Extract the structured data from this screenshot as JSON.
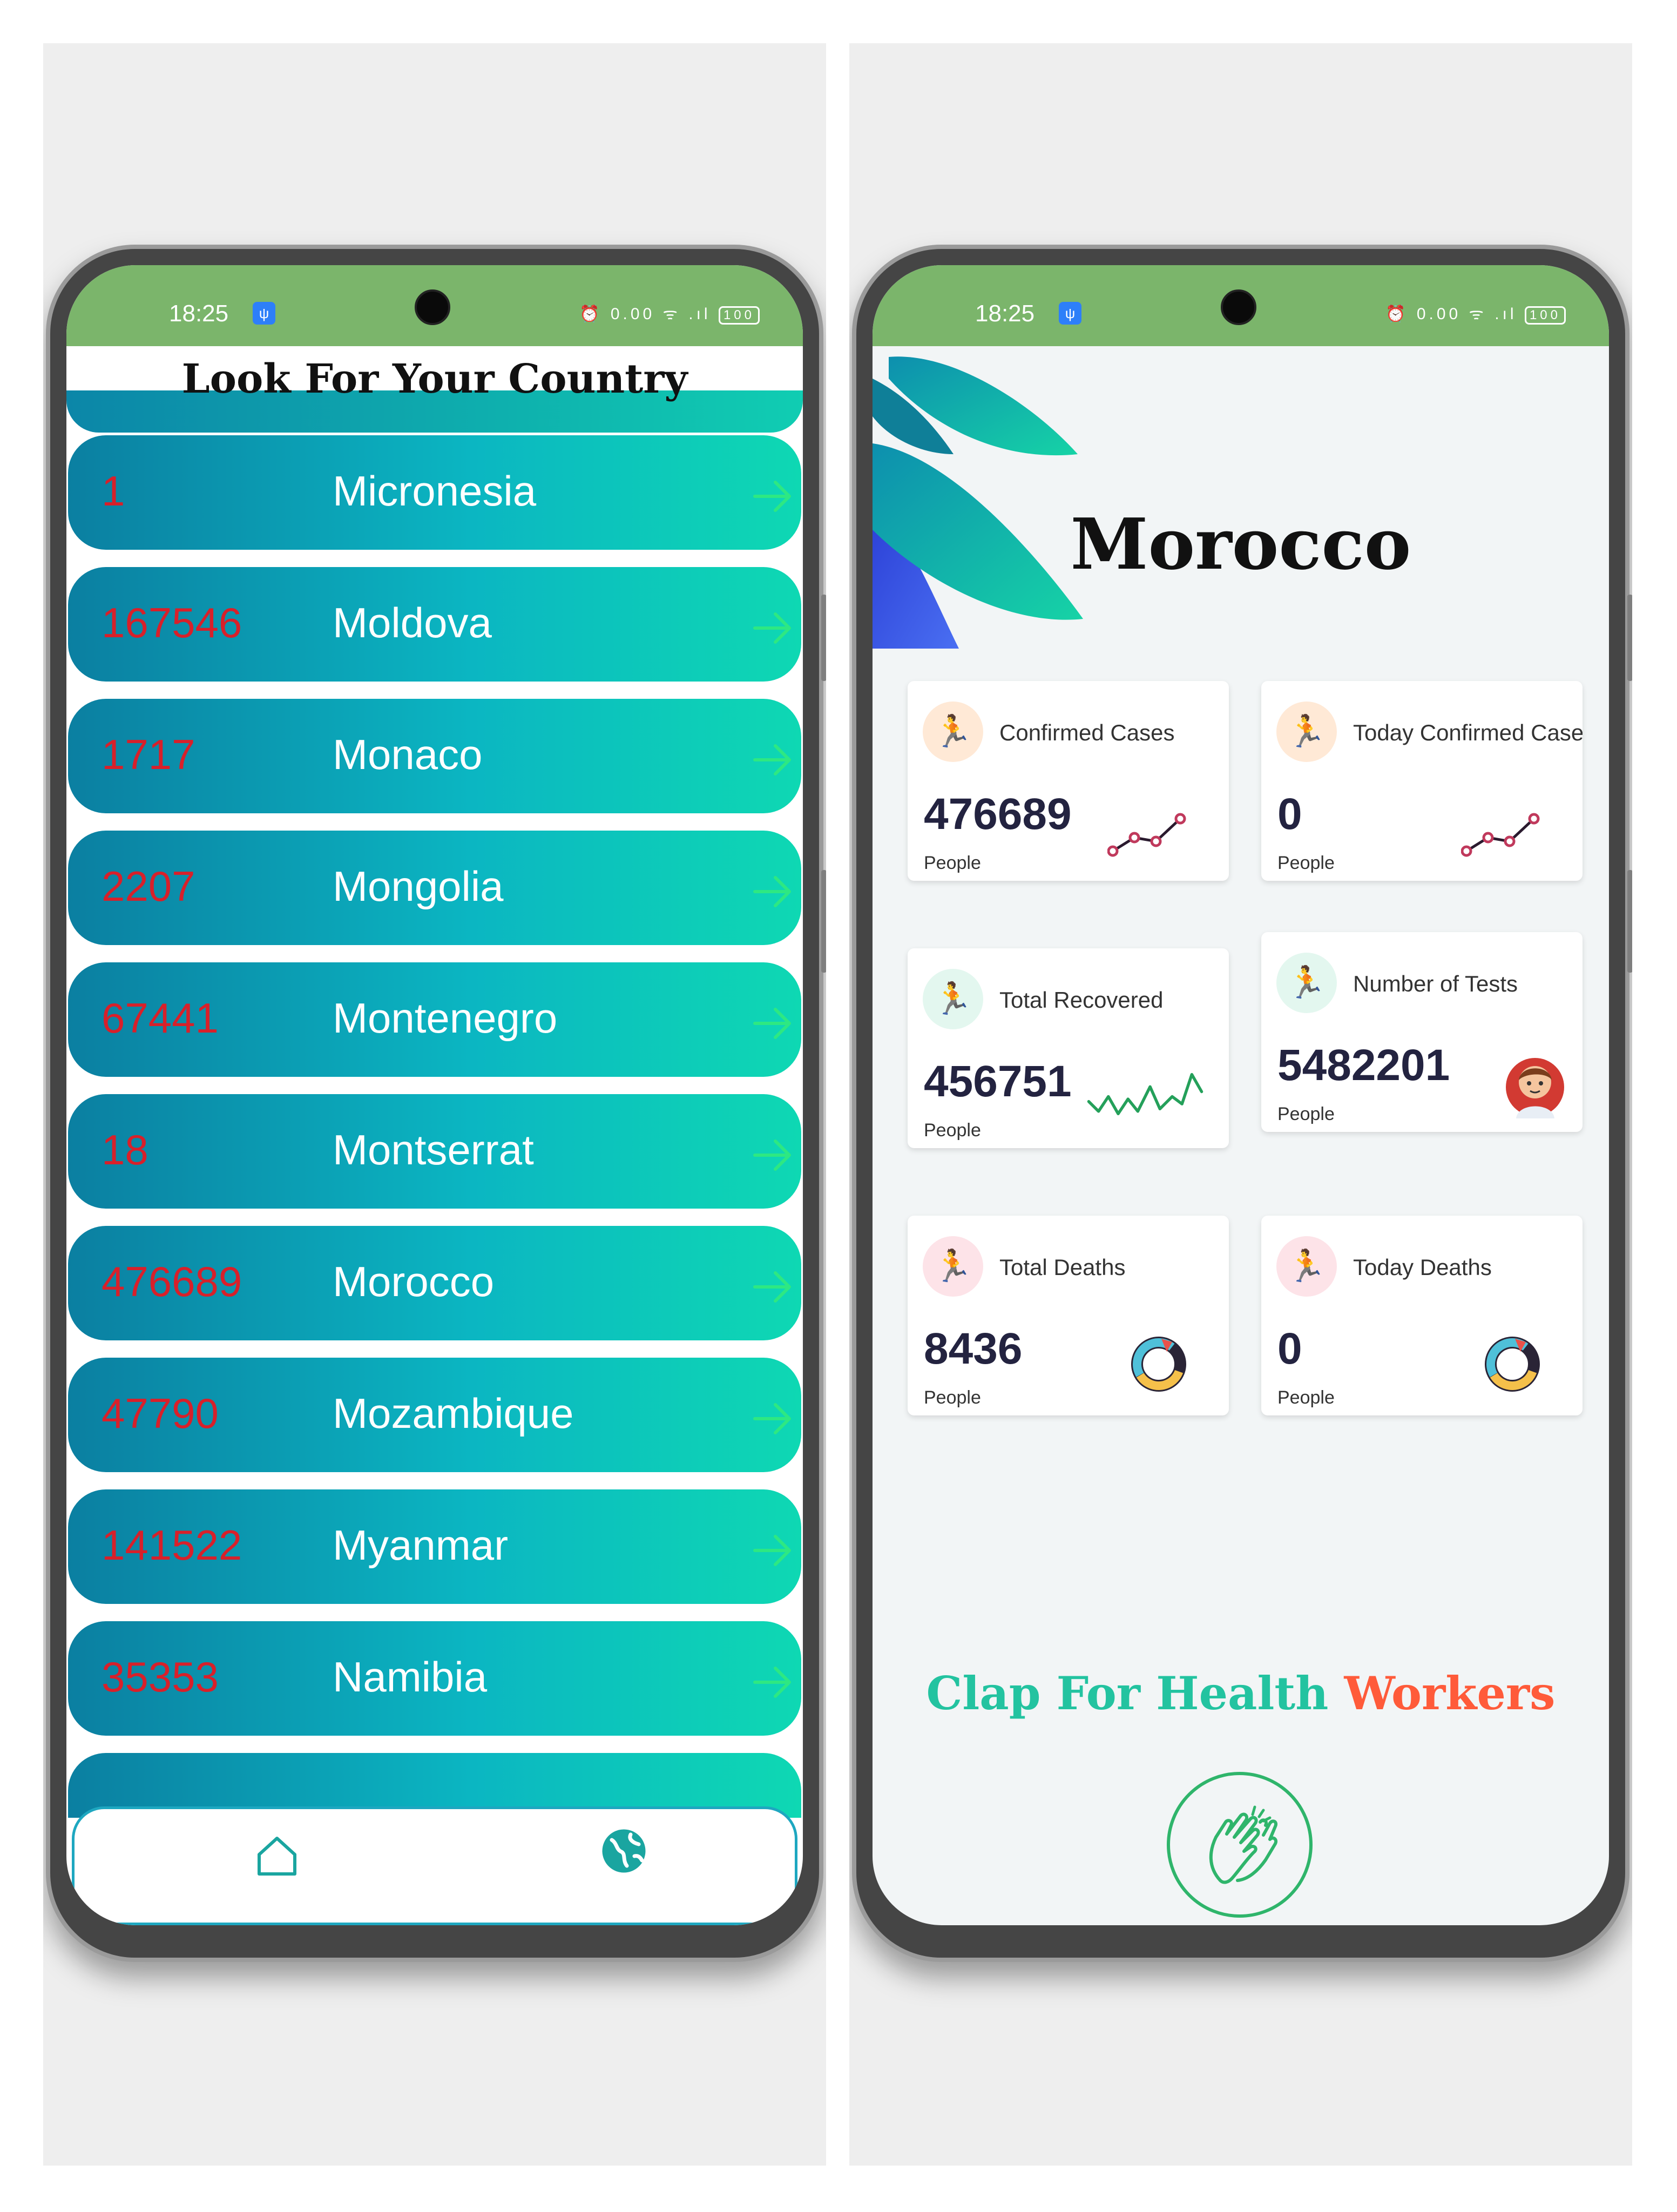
{
  "status_bar": {
    "time": "18:25",
    "right_text": "⏰ 0.00 ᯤ .ıl",
    "battery": "100"
  },
  "list_screen": {
    "title": "Look For Your Country",
    "rows": [
      {
        "number": "1",
        "country": "Micronesia"
      },
      {
        "number": "167546",
        "country": "Moldova"
      },
      {
        "number": "1717",
        "country": "Monaco"
      },
      {
        "number": "2207",
        "country": "Mongolia"
      },
      {
        "number": "67441",
        "country": "Montenegro"
      },
      {
        "number": "18",
        "country": "Montserrat"
      },
      {
        "number": "476689",
        "country": "Morocco"
      },
      {
        "number": "47790",
        "country": "Mozambique"
      },
      {
        "number": "141522",
        "country": "Myanmar"
      },
      {
        "number": "35353",
        "country": "Namibia"
      }
    ],
    "nav": {
      "home_icon": "home-icon",
      "globe_icon": "globe-icon"
    }
  },
  "detail_screen": {
    "country": "Morocco",
    "cards": [
      {
        "label": "Confirmed Cases",
        "value": "476689",
        "unit": "People"
      },
      {
        "label": "Today Confirmed Cases",
        "value": "0",
        "unit": "People"
      },
      {
        "label": "Total Recovered",
        "value": "456751",
        "unit": "People"
      },
      {
        "label": "Number of Tests",
        "value": "5482201",
        "unit": "People"
      },
      {
        "label": "Total Deaths",
        "value": "8436",
        "unit": "People"
      },
      {
        "label": "Today Deaths",
        "value": "0",
        "unit": "People"
      }
    ],
    "clap_title_part1": "Clap For Health ",
    "clap_title_part2": "Workers"
  },
  "colors": {
    "status_bar": "#7bb56b",
    "row_gradient_start": "#0b7fa1",
    "row_gradient_end": "#0ed8b3",
    "row_number": "#d8202a",
    "clap_green": "#23c3a0",
    "clap_orange": "#ff5b3a"
  }
}
